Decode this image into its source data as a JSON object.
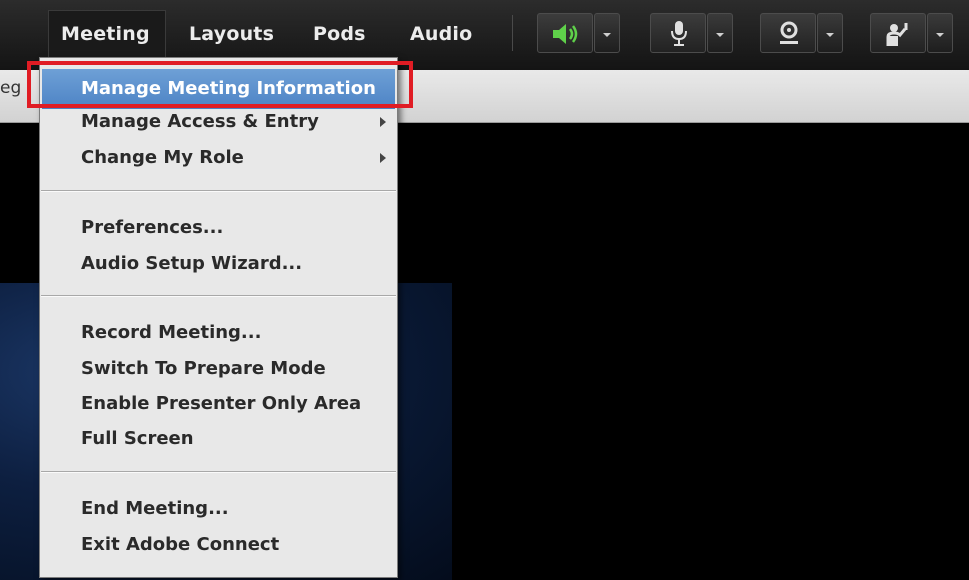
{
  "menubar": {
    "items": [
      {
        "label": "Meeting"
      },
      {
        "label": "Layouts"
      },
      {
        "label": "Pods"
      },
      {
        "label": "Audio"
      }
    ],
    "icons": {
      "speaker": "speaker-icon",
      "microphone": "microphone-icon",
      "webcam": "webcam-icon",
      "raise_hand": "raise-hand-icon"
    },
    "speaker_color": "#5fd14a"
  },
  "subbar": {
    "partial_text": "eg"
  },
  "meeting_menu": {
    "items": [
      {
        "label": "Manage Meeting Information",
        "highlighted": true
      },
      {
        "label": "Manage Access & Entry",
        "submenu": true
      },
      {
        "label": "Change My Role",
        "submenu": true
      },
      {
        "label": "Preferences..."
      },
      {
        "label": "Audio Setup Wizard..."
      },
      {
        "label": "Record Meeting..."
      },
      {
        "label": "Switch To Prepare Mode"
      },
      {
        "label": "Enable Presenter Only Area"
      },
      {
        "label": "Full Screen"
      },
      {
        "label": "End Meeting..."
      },
      {
        "label": "Exit Adobe Connect"
      }
    ]
  },
  "colors": {
    "highlight": "#4d83c5",
    "annotation_box": "#e01c24"
  }
}
